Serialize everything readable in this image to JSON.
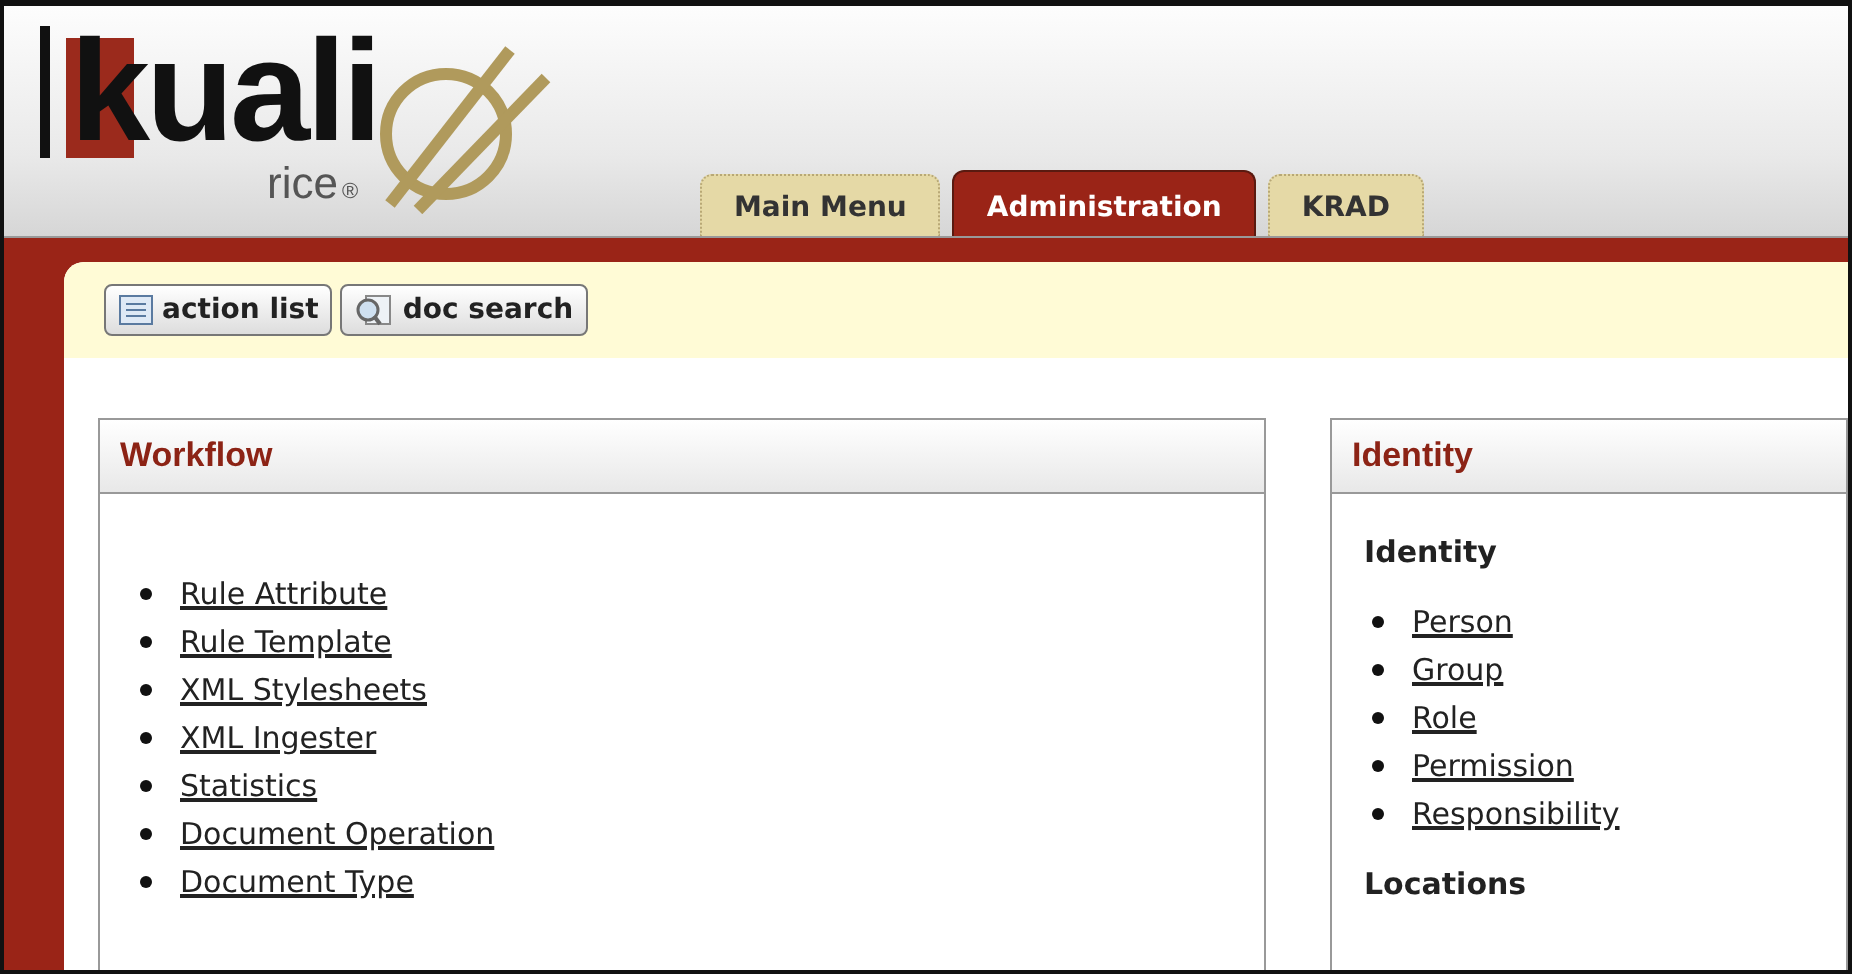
{
  "logo": {
    "name": "kuali",
    "sub": "rice",
    "mark": "®"
  },
  "tabs": [
    {
      "label": "Main Menu",
      "selected": false
    },
    {
      "label": "Administration",
      "selected": true
    },
    {
      "label": "KRAD",
      "selected": false
    }
  ],
  "toolbar": [
    {
      "label": "action list",
      "kind": "list"
    },
    {
      "label": "doc search",
      "kind": "search"
    }
  ],
  "panels": [
    {
      "title": "Workflow",
      "sections": [
        {
          "links": [
            "Rule Attribute",
            "Rule Template",
            "XML Stylesheets",
            "XML Ingester",
            "Statistics",
            "Document Operation",
            "Document Type"
          ]
        }
      ]
    },
    {
      "title": "Identity",
      "sections": [
        {
          "heading": "Identity",
          "links": [
            "Person",
            "Group",
            "Role",
            "Permission",
            "Responsibility"
          ]
        },
        {
          "heading": "Locations"
        }
      ]
    }
  ]
}
